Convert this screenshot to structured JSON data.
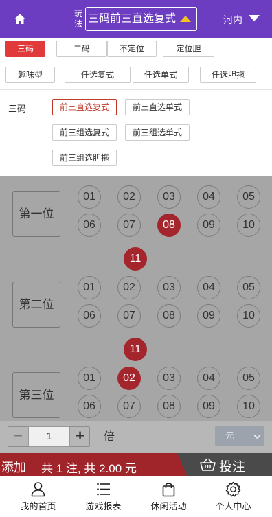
{
  "header": {
    "play_label": "玩法",
    "mode": "三码前三直选复式",
    "region": "河内"
  },
  "categories": [
    "三码",
    "二码",
    "不定位",
    "定位胆",
    "趣味型",
    "任选复式",
    "任选单式",
    "任选胆拖"
  ],
  "active_category": "三码",
  "subtypes": {
    "label": "三码",
    "items": [
      "前三直选复式",
      "前三直选单式",
      "前三组选复式",
      "前三组选单式",
      "前三组选胆拖"
    ],
    "active": "前三直选复式"
  },
  "positions": [
    {
      "label": "第一位",
      "balls": [
        "01",
        "02",
        "03",
        "04",
        "05",
        "06",
        "07",
        "08",
        "09",
        "10",
        "11"
      ],
      "selected": [
        "08",
        "11"
      ]
    },
    {
      "label": "第二位",
      "balls": [
        "01",
        "02",
        "03",
        "04",
        "05",
        "06",
        "07",
        "08",
        "09",
        "10",
        "11"
      ],
      "selected": [
        "11"
      ]
    },
    {
      "label": "第三位",
      "balls": [
        "01",
        "02",
        "03",
        "04",
        "05",
        "06",
        "07",
        "08",
        "09",
        "10"
      ],
      "selected": [
        "02"
      ]
    }
  ],
  "multiplier": {
    "minus": "−",
    "value": "1",
    "plus": "+",
    "label": "倍"
  },
  "unit": "元",
  "action": {
    "add": "添加",
    "summary": "共 1 注, 共 2.00 元",
    "bet": "投注"
  },
  "nav": [
    {
      "label": "我的首页",
      "icon": "user-icon"
    },
    {
      "label": "游戏报表",
      "icon": "list-icon"
    },
    {
      "label": "休闲活动",
      "icon": "bag-icon"
    },
    {
      "label": "个人中心",
      "icon": "gear-icon"
    }
  ],
  "colors": {
    "header": "#6c3cc1",
    "active_red": "#e03a3a",
    "ball_selected": "#a4262c",
    "mode_arrow": "#f5c518"
  }
}
